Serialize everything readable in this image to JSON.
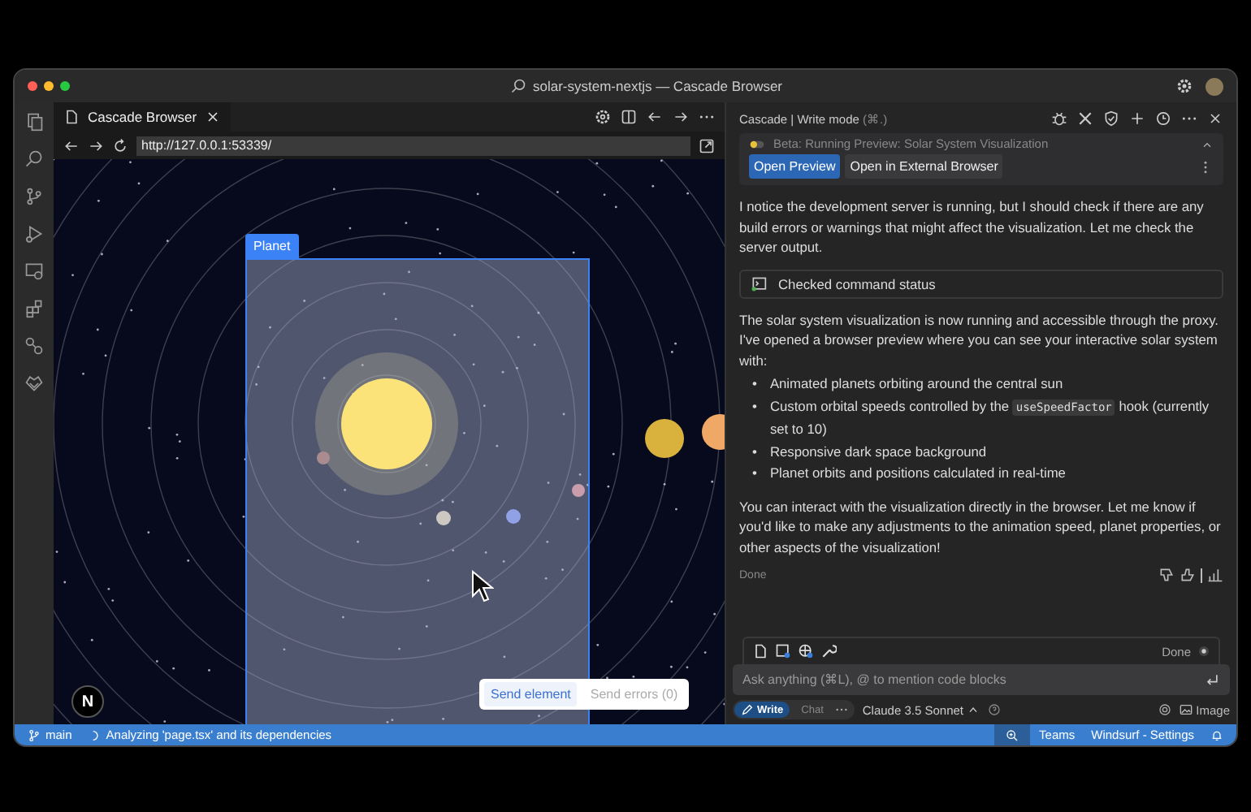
{
  "window": {
    "title": "solar-system-nextjs — Cascade Browser"
  },
  "browser": {
    "tab": {
      "label": "Cascade Browser"
    },
    "url": "http://127.0.0.1:53339/",
    "selection": {
      "label": "Planet"
    },
    "actions": [
      {
        "label": "Send element",
        "disabled": false
      },
      {
        "label": "Send errors (0)",
        "disabled": true
      }
    ],
    "badge": "N"
  },
  "cascade": {
    "title": "Cascade | Write mode",
    "shortcut": "(⌘.)",
    "preview": {
      "title": "Beta: Running Preview: Solar System Visualization",
      "buttons": [
        {
          "label": "Open Preview",
          "primary": true
        },
        {
          "label": "Open in External Browser",
          "primary": false
        }
      ]
    },
    "messages": [
      {
        "kind": "paragraph",
        "text": "I notice the development server is running, but I should check if there are any build errors or warnings that might affect the visualization. Let me check the server output."
      },
      {
        "kind": "tool",
        "text": "Checked command status"
      },
      {
        "kind": "paragraph",
        "text": "The solar system visualization is now running and accessible through the proxy. I've opened a browser preview where you can see your interactive solar system with:"
      },
      {
        "kind": "list",
        "marker": "•",
        "items": [
          [
            {
              "kind": "text",
              "text": "Animated planets orbiting around the central sun"
            }
          ],
          [
            {
              "kind": "text",
              "text": "Custom orbital speeds controlled by the "
            },
            {
              "kind": "code",
              "text": "useSpeedFactor"
            },
            {
              "kind": "text",
              "text": " hook (currently set to 10)"
            }
          ],
          [
            {
              "kind": "text",
              "text": "Responsive dark space background"
            }
          ],
          [
            {
              "kind": "text",
              "text": "Planet orbits and positions calculated in real-time"
            }
          ]
        ]
      },
      {
        "kind": "paragraph",
        "text": "You can interact with the visualization directly in the browser. Let me know if you'd like to make any adjustments to the animation speed, planet properties, or other aspects of the visualization!"
      }
    ],
    "status": "Done",
    "composer": {
      "status": "Done",
      "placeholder": "Ask anything (⌘L), @ to mention code blocks",
      "modes": [
        {
          "label": "Write",
          "selected": true
        },
        {
          "label": "Chat",
          "selected": false
        }
      ],
      "model": "Claude 3.5 Sonnet",
      "image_label": "Image"
    }
  },
  "status_bar": {
    "branch": "main",
    "task": "Analyzing 'page.tsx' and its dependencies",
    "items": [
      "Teams",
      "Windsurf - Settings"
    ]
  }
}
